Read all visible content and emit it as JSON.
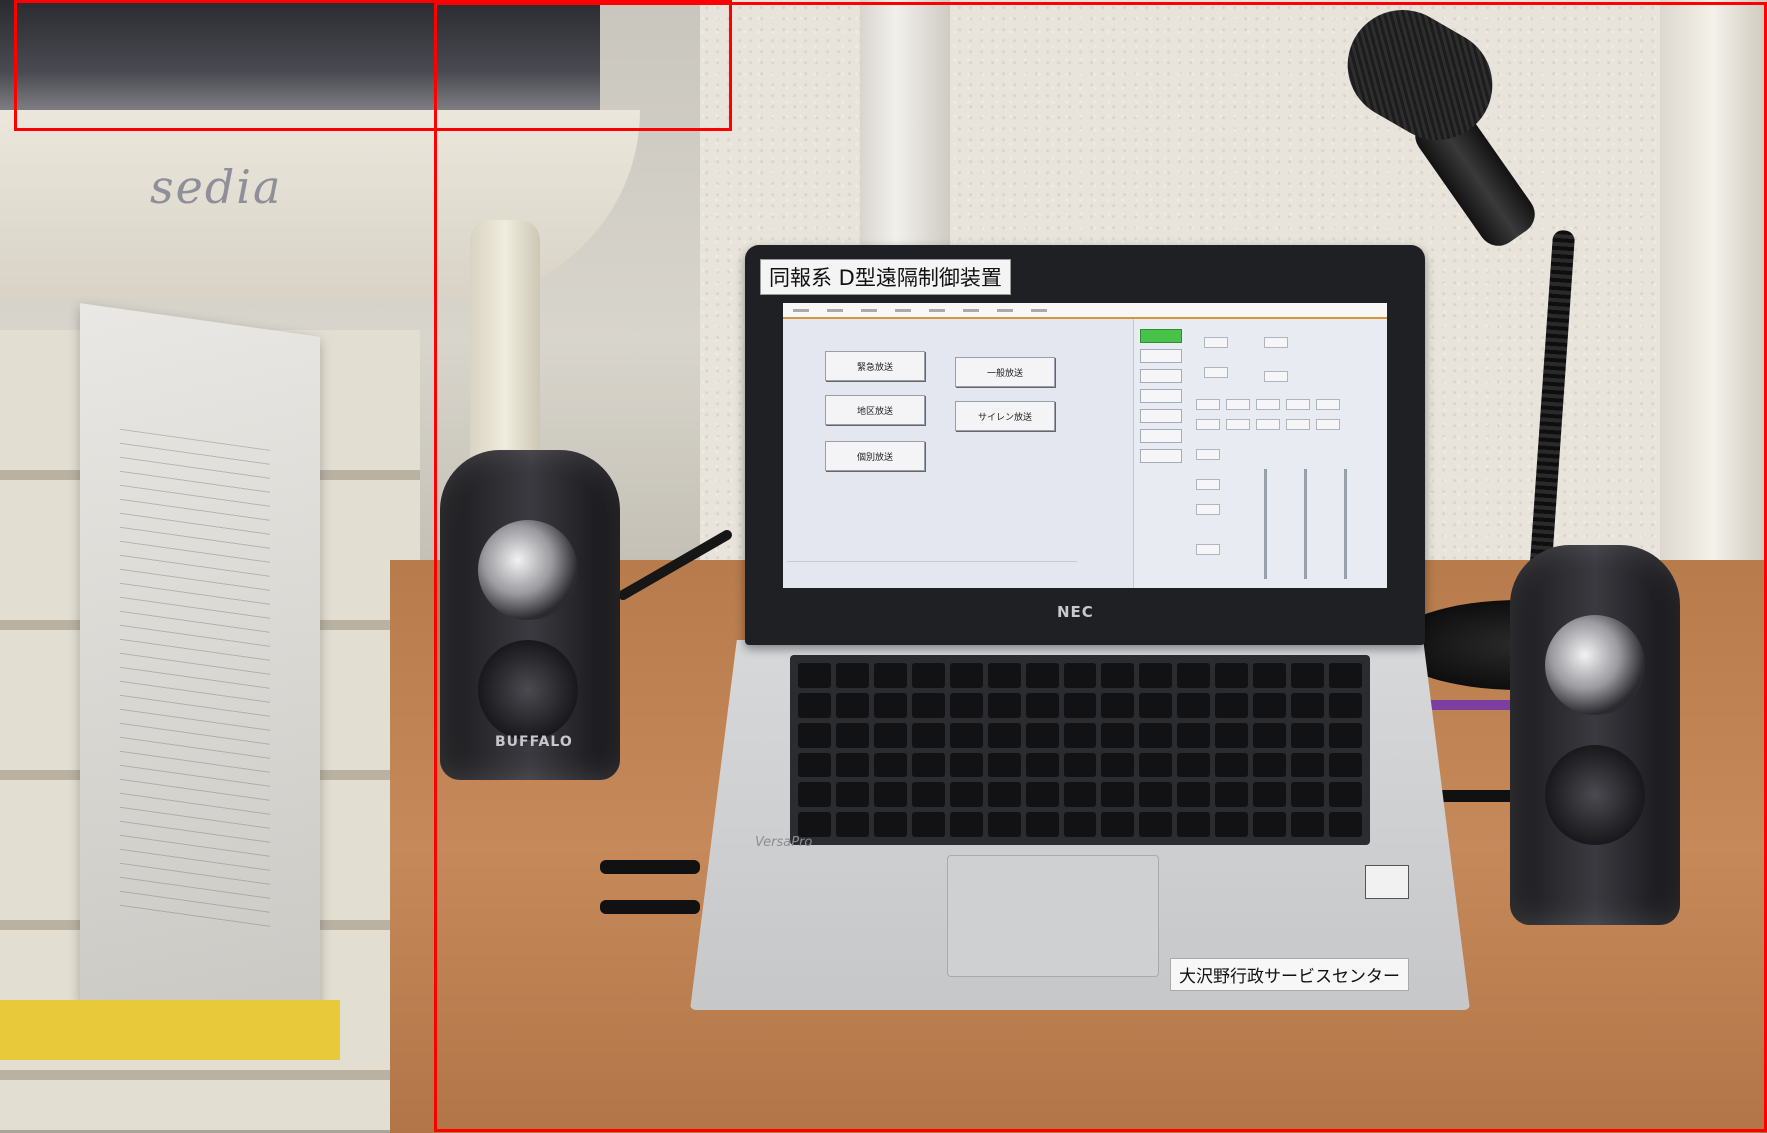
{
  "laptop": {
    "lid_label": "同報系 D型遠隔制御装置",
    "brand": "NEC",
    "model": "VersaPro",
    "base_label": "大沢野行政サービスセンター",
    "screen": {
      "main_buttons": [
        "緊急放送",
        "一般放送",
        "地区放送",
        "サイレン放送",
        "個別放送"
      ]
    }
  },
  "tray": {
    "brand": "sedia"
  },
  "speaker_left": {
    "brand": "BUFFALO"
  },
  "annotations": {
    "color": "#ff0000",
    "count": 2
  }
}
